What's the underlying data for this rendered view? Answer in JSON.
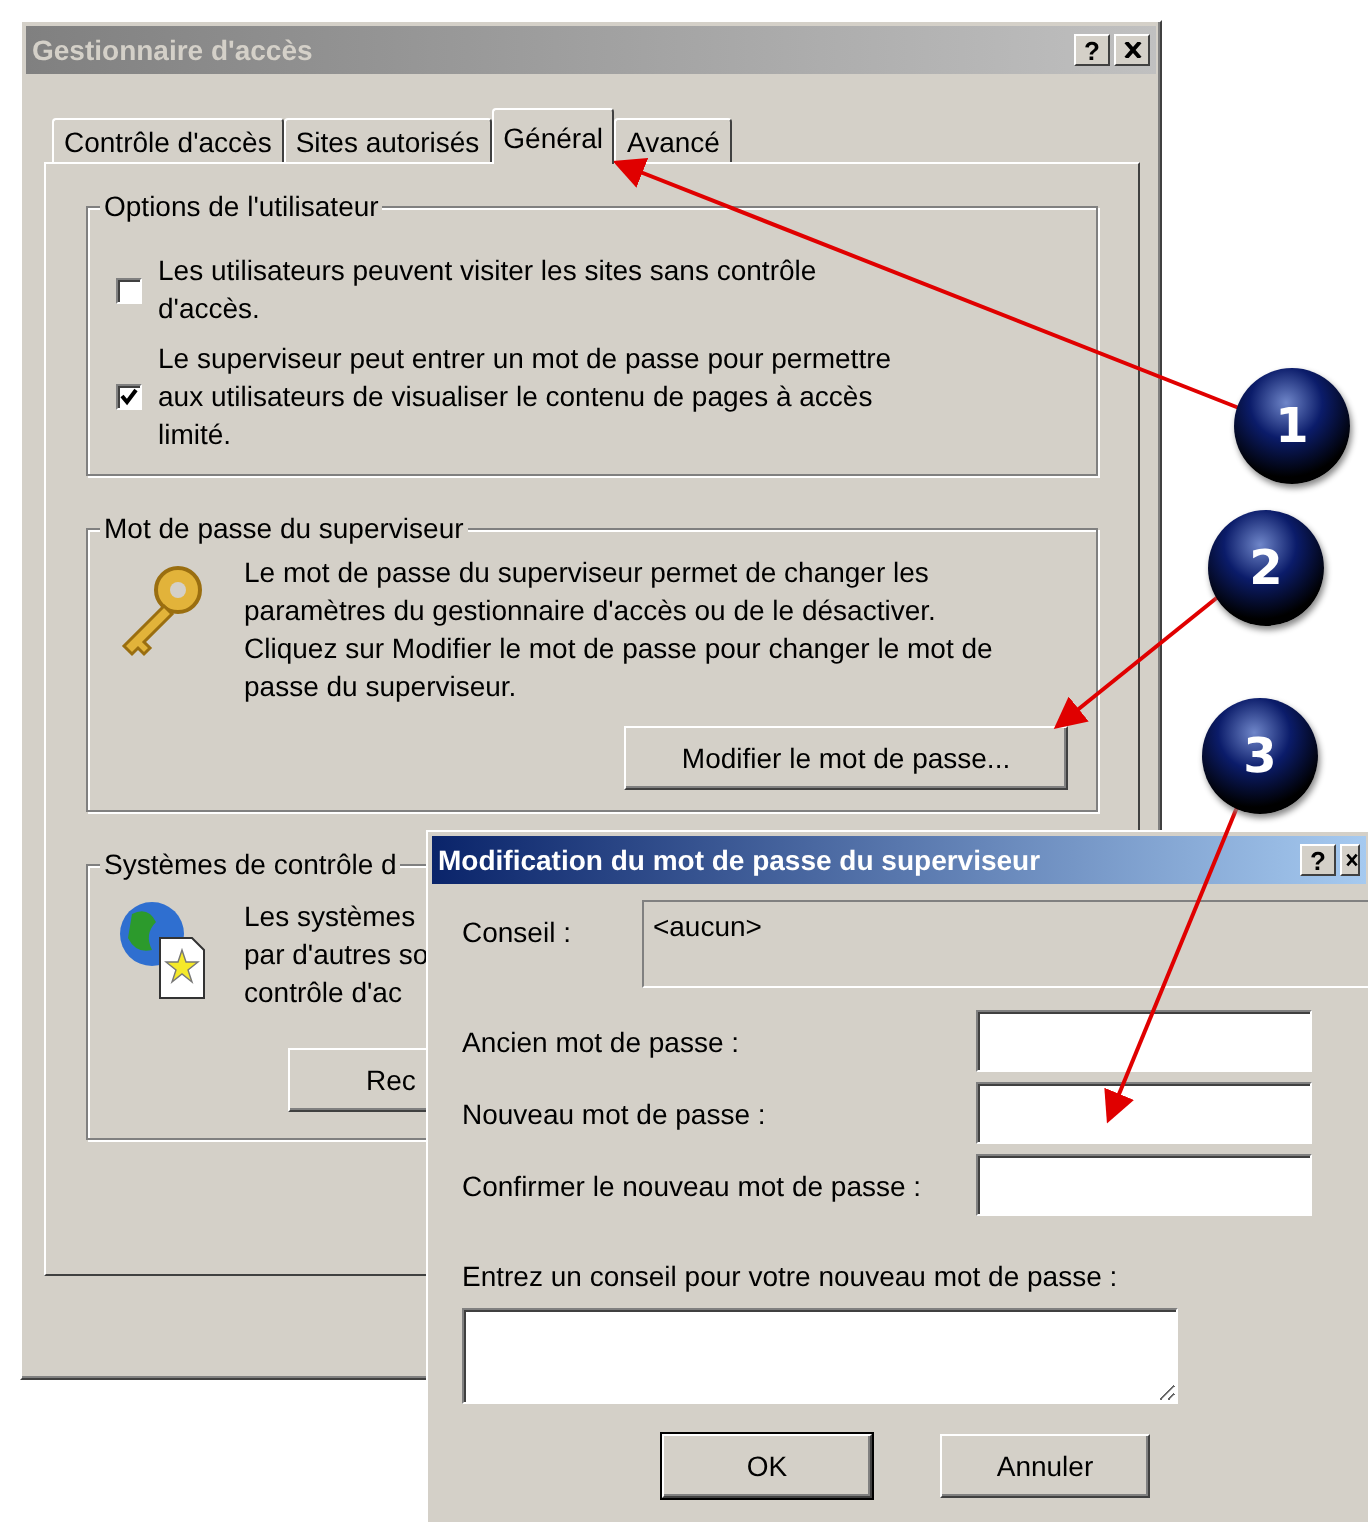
{
  "main_window": {
    "title": "Gestionnaire d'accès",
    "help_button": "?",
    "tabs": [
      {
        "label": "Contrôle d'accès",
        "selected": false
      },
      {
        "label": "Sites autorisés",
        "selected": false
      },
      {
        "label": "Général",
        "selected": true
      },
      {
        "label": "Avancé",
        "selected": false
      }
    ],
    "user_options": {
      "title": "Options de l'utilisateur",
      "checkboxes": [
        {
          "label": "Les utilisateurs peuvent visiter les sites sans contrôle d'accès.",
          "checked": false
        },
        {
          "label": "Le superviseur peut entrer un mot de passe pour permettre aux utilisateurs de visualiser le contenu de pages à accès limité.",
          "checked": true
        }
      ]
    },
    "supervisor_password": {
      "title": "Mot de passe du superviseur",
      "description": "Le mot de passe du superviseur permet de changer les paramètres du gestionnaire d'accès ou de le désactiver. Cliquez sur Modifier le mot de passe pour changer le mot de passe du superviseur.",
      "button": "Modifier le mot de passe..."
    },
    "access_systems": {
      "title": "Systèmes de contrôle d",
      "description_lines": [
        "Les systèmes",
        "par d'autres so",
        "contrôle d'ac"
      ],
      "button": "Rec"
    }
  },
  "dialog": {
    "title": "Modification du mot de passe du superviseur",
    "help_button": "?",
    "hint_label": "Conseil :",
    "hint_value": "<aucun>",
    "fields": [
      {
        "label": "Ancien mot de passe :"
      },
      {
        "label": "Nouveau mot de passe :"
      },
      {
        "label": "Confirmer le nouveau mot de passe :"
      }
    ],
    "new_hint_label": "Entrez un conseil pour votre nouveau mot de passe :",
    "buttons": [
      "OK",
      "Annuler"
    ]
  },
  "annotations": [
    {
      "number": "1"
    },
    {
      "number": "2"
    },
    {
      "number": "3"
    }
  ]
}
